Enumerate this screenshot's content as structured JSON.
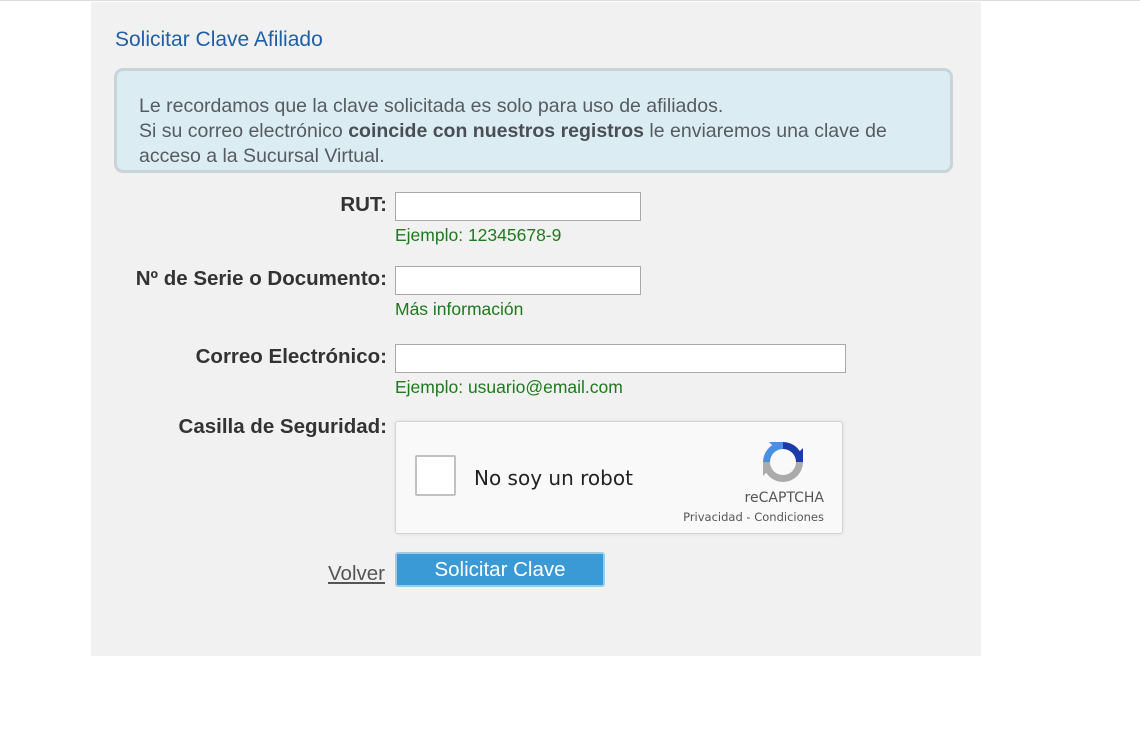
{
  "page": {
    "title": "Solicitar Clave Afiliado"
  },
  "info": {
    "line1": "Le recordamos que la clave solicitada es solo para uso de afiliados.",
    "line2_pre": "Si su correo electrónico ",
    "line2_bold": "coincide con nuestros registros",
    "line2_post": "  le enviaremos una clave de acceso a la Sucursal Virtual."
  },
  "form": {
    "rut_label": "RUT:",
    "rut_value": "",
    "rut_hint": "Ejemplo: 12345678-9",
    "serie_label": "Nº de Serie o Documento:",
    "serie_value": "",
    "serie_hint": "Más información",
    "email_label": "Correo Electrónico:",
    "email_value": "",
    "email_hint": "Ejemplo: usuario@email.com",
    "captcha_label": "Casilla de Seguridad:"
  },
  "captcha": {
    "checkbox_label": "No soy un robot",
    "brand": "reCAPTCHA",
    "links": "Privacidad - Condiciones",
    "icon": "recaptcha-logo-icon"
  },
  "actions": {
    "back_label": "Volver",
    "submit_label": "Solicitar Clave"
  },
  "colors": {
    "title": "#1f5fa8",
    "hint": "#1d7a1d",
    "submit_bg": "#3a9ad5",
    "info_bg": "#dcecf3"
  }
}
